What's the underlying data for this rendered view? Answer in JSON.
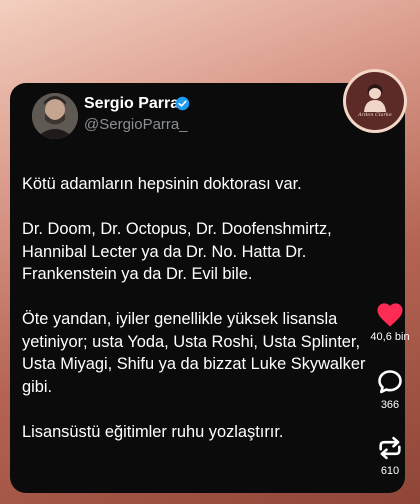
{
  "tweet": {
    "author_name": "Sergio Parra",
    "author_handle": "@SergioParra_",
    "paragraphs": [
      [
        "Kötü adamların hepsinin doktorası var."
      ],
      [
        "Dr. Doom, Dr. Octopus, Dr. Doofenshmirtz,",
        "Hannibal Lecter ya da Dr. No. Hatta Dr.",
        "Frankenstein ya da Dr. Evil bile."
      ],
      [
        "Öte yandan, iyiler genellikle yüksek lisansla",
        "yetiniyor; usta Yoda, Usta Roshi, Usta Splinter,",
        "Usta Miyagi, Shifu ya da bizzat Luke Skywalker",
        "gibi."
      ],
      [
        "Lisansüstü eğitimler ruhu yozlaştırır."
      ]
    ]
  },
  "profile_badge": {
    "label": "Arden Clarke"
  },
  "actions": {
    "like_count": "40,6 bin",
    "comment_count": "366",
    "share_count": "610"
  },
  "colors": {
    "like": "#fe2c55",
    "card": "#0b0b0b",
    "verified": "#1d9bf0"
  },
  "icons": [
    "heart-icon",
    "comment-icon",
    "share-icon",
    "verified-icon"
  ]
}
